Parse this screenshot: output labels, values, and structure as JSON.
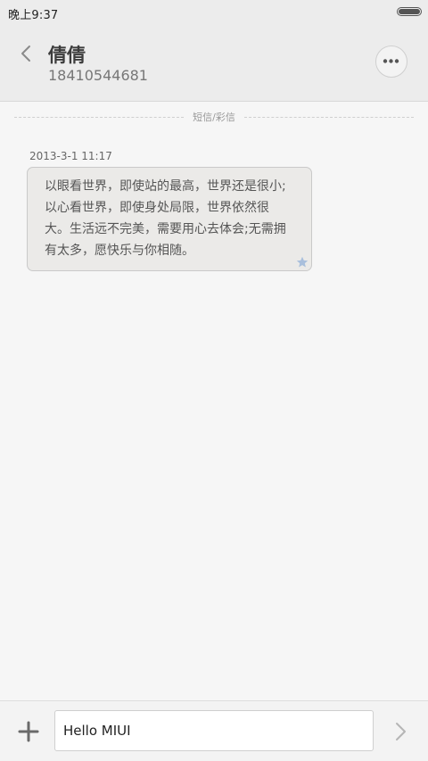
{
  "status_bar": {
    "time": "晚上9:37",
    "battery_icon": "battery-icon"
  },
  "header": {
    "back_icon": "chevron-left-icon",
    "contact_name": "倩倩",
    "contact_number": "18410544681",
    "more_icon": "more-dots-icon"
  },
  "thread": {
    "divider_label": "短信/彩信",
    "messages": [
      {
        "timestamp": "2013-3-1 11:17",
        "text": "以眼看世界，即使站的最高，世界还是很小;以心看世界，即使身处局限，世界依然很大。生活远不完美，需要用心去体会;无需拥有太多，愿快乐与你相随。",
        "starred_icon": "star-icon"
      }
    ]
  },
  "composer": {
    "add_icon": "plus-icon",
    "input_value": "Hello MIUI",
    "send_icon": "chevron-right-icon"
  },
  "colors": {
    "header_bg": "#ececec",
    "page_bg": "#f6f6f6",
    "bubble_bg": "#ebeae8",
    "star": "#a9bfdc"
  }
}
